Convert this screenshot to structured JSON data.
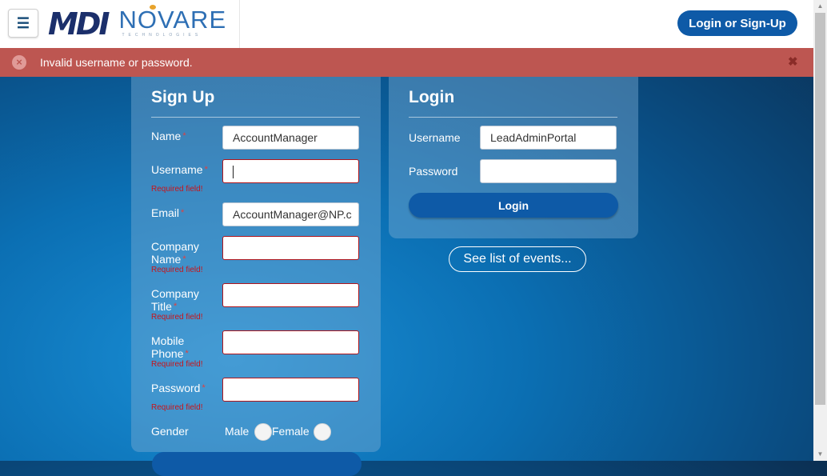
{
  "header": {
    "menu_icon": "hamburger-icon",
    "logo": {
      "mdi": "MDI",
      "novare": "NOVARE",
      "novare_sub": "TECHNOLOGIES"
    },
    "login_button": "Login or Sign-Up"
  },
  "alert": {
    "message": "Invalid username or password.",
    "icon": "error-circle-icon",
    "close": "✖",
    "colors": {
      "background": "#bd5651"
    }
  },
  "signup": {
    "title": "Sign Up",
    "required_text": "Required field!",
    "fields": {
      "name": {
        "label": "Name",
        "value": "AccountManager"
      },
      "username": {
        "label": "Username",
        "value": ""
      },
      "email": {
        "label": "Email",
        "value": "AccountManager@NP.c"
      },
      "company_name": {
        "label_1": "Company",
        "label_2": "Name",
        "value": ""
      },
      "company_title": {
        "label_1": "Company",
        "label_2": "Title",
        "value": ""
      },
      "mobile_phone": {
        "label_1": "Mobile",
        "label_2": "Phone",
        "value": ""
      },
      "password": {
        "label": "Password",
        "value": ""
      }
    },
    "gender": {
      "label": "Gender",
      "male": "Male",
      "female": "Female"
    }
  },
  "login": {
    "title": "Login",
    "username_label": "Username",
    "username_value": "LeadAdminPortal",
    "password_label": "Password",
    "password_value": "",
    "submit": "Login"
  },
  "events_link": "See list of events...",
  "colors": {
    "accent": "#0e5aa7",
    "error": "#c8141a"
  }
}
